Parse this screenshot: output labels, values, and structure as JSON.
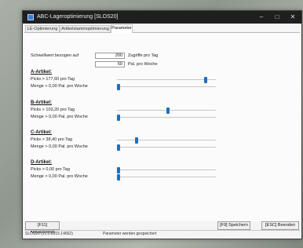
{
  "window": {
    "title": "ABC-Lageroptimierung [SLOS20]",
    "minimize_glyph": "–",
    "maximize_glyph": "□",
    "close_glyph": "✕"
  },
  "tabs": [
    {
      "label": "LE-Optimierung"
    },
    {
      "label": "Artikelstammoptimierung"
    },
    {
      "label": "Parameter"
    }
  ],
  "params": {
    "threshold_label": "Schwellwert bezogen auf",
    "accesses_value": "200",
    "accesses_unit": "Zugriffe pro Tag",
    "pallets_value": "50",
    "pallets_unit": "Pal. pro Woche"
  },
  "articles": [
    {
      "heading": "A-Artikel:",
      "picks_label": "Picks > 177,60 pro Tag",
      "menge_label": "Menge > 0,00 Pal. pro Woche",
      "picks_fraction": 0.91,
      "menge_fraction": 0.0
    },
    {
      "heading": "B-Artikel:",
      "picks_label": "Picks > 103,20 pro Tag",
      "menge_label": "Menge > 0,00 Pal. pro Woche",
      "picks_fraction": 0.52,
      "menge_fraction": 0.0
    },
    {
      "heading": "C-Artikel:",
      "picks_label": "Picks > 38,40 pro Tag",
      "menge_label": "Menge > 0,00 Pal. pro Woche",
      "picks_fraction": 0.19,
      "menge_fraction": 0.0
    },
    {
      "heading": "D-Artikel:",
      "picks_label": "Picks > 0,00 pro Tag",
      "menge_label": "Menge > 0,00 Pal. pro Woche",
      "picks_fraction": 0.0,
      "menge_fraction": 0.0
    }
  ],
  "buttons": {
    "refresh": "[F11] Aktualisieren",
    "save": "[F9] Speichern",
    "quit": "[ESC] Beenden"
  },
  "status": {
    "version": "SLOS20 (v1.0.6015.14662)",
    "message": "Parameter werden gespeichert"
  },
  "colors": {
    "accent": "#1e6fbf",
    "titlebar": "#1f1f1f"
  }
}
